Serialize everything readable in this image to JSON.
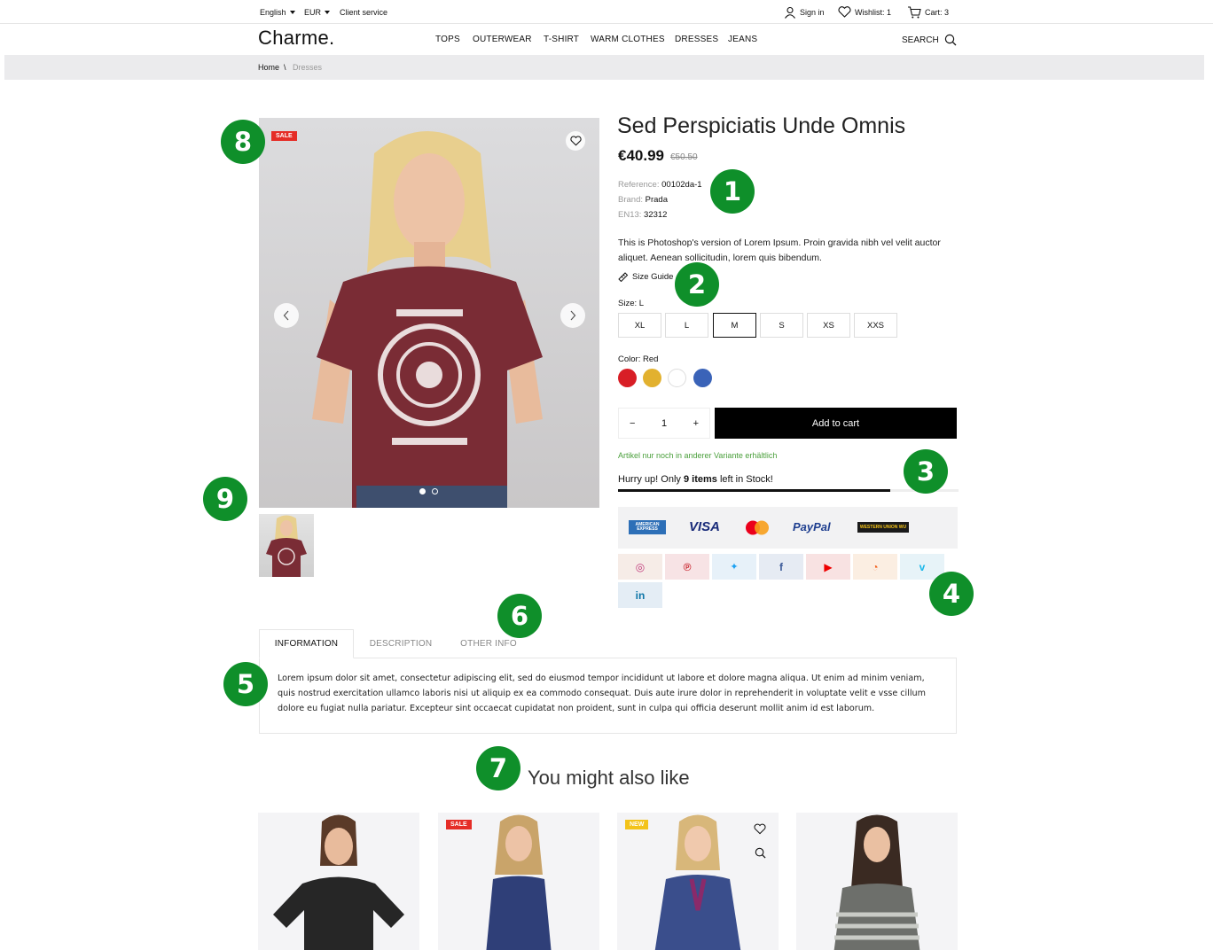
{
  "topbar": {
    "language": "English",
    "currency": "EUR",
    "client_service": "Client service",
    "sign_in": "Sign in",
    "wishlist": "Wishlist: 1",
    "cart": "Cart: 3"
  },
  "header": {
    "logo": "Charme.",
    "nav": [
      "TOPS",
      "OUTERWEAR",
      "T-SHIRT",
      "WARM CLOTHES",
      "DRESSES",
      "JEANS"
    ],
    "search": "SEARCH"
  },
  "breadcrumb": {
    "home": "Home",
    "separator": "\\",
    "current": "Dresses"
  },
  "product": {
    "sale_badge": "SALE",
    "title": "Sed Perspiciatis Unde Omnis",
    "price": "€40.99",
    "old_price": "€50.50",
    "reference_label": "Reference:",
    "reference": "00102da-1",
    "brand_label": "Brand:",
    "brand": "Prada",
    "ean_label": "EN13:",
    "ean": "32312",
    "description": "This is Photoshop's version  of Lorem Ipsum. Proin gravida nibh vel velit auctor aliquet. Aenean sollicitudin, lorem quis bibendum.",
    "size_guide": "Size Guide",
    "size_label": "Size: L",
    "sizes": [
      "XL",
      "L",
      "M",
      "S",
      "XS",
      "XXS"
    ],
    "color_label": "Color: Red",
    "colors": [
      "#d81e26",
      "#e2b12f",
      "#ffffff",
      "#3a63b8"
    ],
    "qty_minus": "−",
    "qty": "1",
    "qty_plus": "+",
    "add_to_cart": "Add to cart",
    "availability": "Artikel nur noch in anderer Variante erhältlich",
    "stock_prefix": "Hurry up! Only ",
    "stock_count": "9 items",
    "stock_suffix": " left in Stock!",
    "stock_level": 0.8,
    "payments": [
      "AMERICAN EXPRESS",
      "VISA",
      "PayPal",
      "WESTERN UNION WU"
    ],
    "socials": [
      "instagram-icon",
      "pinterest-icon",
      "twitter-icon",
      "facebook-icon",
      "youtube-icon",
      "rss-icon",
      "vimeo-icon",
      "linkedin-icon"
    ],
    "social_glyphs": [
      "◎",
      "℗",
      "🐦",
      "f",
      "▶",
      "◔",
      "v",
      "in"
    ]
  },
  "tabs": {
    "items": [
      "INFORMATION",
      "DESCRIPTION",
      "OTHER INFO"
    ],
    "content": "Lorem ipsum dolor sit amet, consectetur adipiscing elit, sed do eiusmod tempor incididunt ut labore et dolore magna aliqua. Ut enim ad minim veniam, quis nostrud exercitation ullamco laboris nisi ut aliquip ex ea commodo consequat. Duis aute irure dolor in reprehenderit in voluptate velit e vsse cillum dolore eu fugiat nulla pariatur. Excepteur sint occaecat cupidatat non proident, sunt in culpa qui officia deserunt mollit anim id est laborum."
  },
  "related": {
    "title": "You might also like",
    "badges": [
      "",
      "SALE",
      "NEW",
      ""
    ]
  },
  "markers": [
    "1",
    "2",
    "3",
    "4",
    "5",
    "6",
    "7",
    "8",
    "9"
  ]
}
